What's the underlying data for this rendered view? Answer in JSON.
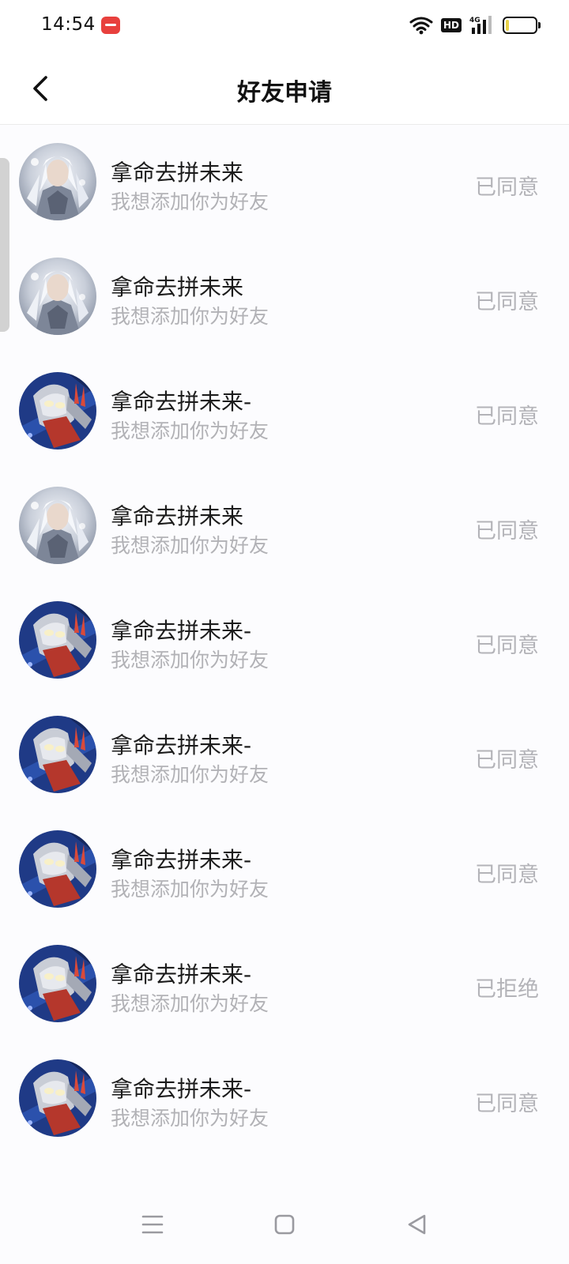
{
  "status_bar": {
    "time": "14:54",
    "hd_label": "HD",
    "network_label": "4G",
    "battery_level": 0.1,
    "icons": [
      "app-notification-icon",
      "wifi-icon",
      "hd-icon",
      "signal-icon",
      "battery-icon"
    ]
  },
  "header": {
    "title": "好友申请",
    "back_icon": "chevron-left-icon"
  },
  "requests": [
    {
      "name": "拿命去拼未来",
      "message": "我想添加你为好友",
      "status": "已同意",
      "avatar": "white-haired-warrior"
    },
    {
      "name": "拿命去拼未来",
      "message": "我想添加你为好友",
      "status": "已同意",
      "avatar": "white-haired-warrior"
    },
    {
      "name": "拿命去拼未来-",
      "message": "我想添加你为好友",
      "status": "已同意",
      "avatar": "ultraman-hero"
    },
    {
      "name": "拿命去拼未来",
      "message": "我想添加你为好友",
      "status": "已同意",
      "avatar": "white-haired-warrior"
    },
    {
      "name": "拿命去拼未来-",
      "message": "我想添加你为好友",
      "status": "已同意",
      "avatar": "ultraman-hero"
    },
    {
      "name": "拿命去拼未来-",
      "message": "我想添加你为好友",
      "status": "已同意",
      "avatar": "ultraman-hero"
    },
    {
      "name": "拿命去拼未来-",
      "message": "我想添加你为好友",
      "status": "已同意",
      "avatar": "ultraman-hero"
    },
    {
      "name": "拿命去拼未来-",
      "message": "我想添加你为好友",
      "status": "已拒绝",
      "avatar": "ultraman-hero"
    },
    {
      "name": "拿命去拼未来-",
      "message": "我想添加你为好友",
      "status": "已同意",
      "avatar": "ultraman-hero"
    }
  ],
  "system_nav": {
    "icons": [
      "menu-icon",
      "home-icon",
      "back-triangle-icon"
    ]
  },
  "colors": {
    "status_text": "#b3b3b8",
    "message_text": "#b2b2b6",
    "name_text": "#1c1c1c",
    "notification_red": "#e8403d"
  }
}
